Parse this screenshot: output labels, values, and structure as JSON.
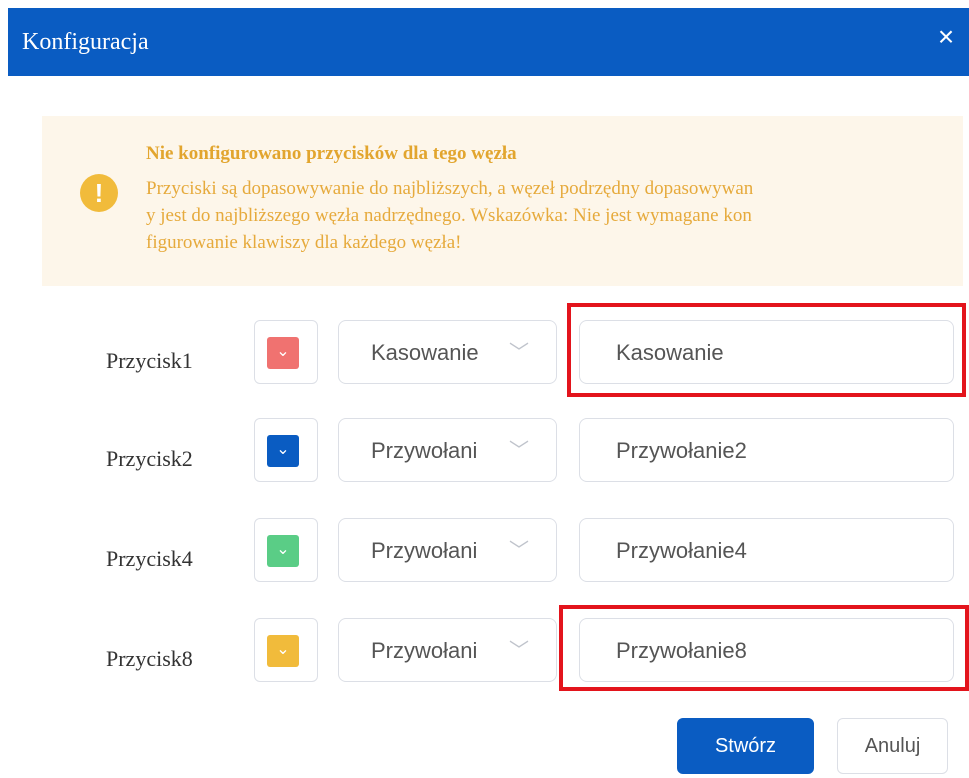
{
  "dialog": {
    "title": "Konfiguracja",
    "close_icon": "×"
  },
  "alert": {
    "icon": "!",
    "heading": "Nie konfigurowano przycisków dla tego węzła",
    "lines": [
      "Przyciski są dopasowywanie do najbliższych, a węzeł podrzędny dopasowywan",
      "y jest do najbliższego węzła nadrzędnego. Wskazówka: Nie jest wymagane kon",
      "figurowanie klawiszy dla każdego węzła!"
    ]
  },
  "rows": [
    {
      "label": "Przycisk1",
      "color": "#f07270",
      "select": "Kasowanie",
      "input": "Kasowanie",
      "highlighted": true
    },
    {
      "label": "Przycisk2",
      "color": "#0a5cc2",
      "select": "Przywołani",
      "input": "Przywołanie2",
      "highlighted": false
    },
    {
      "label": "Przycisk4",
      "color": "#5acd86",
      "select": "Przywołani",
      "input": "Przywołanie4",
      "highlighted": false
    },
    {
      "label": "Przycisk8",
      "color": "#f1bb3b",
      "select": "Przywołani",
      "input": "Przywołanie8",
      "highlighted": true
    }
  ],
  "icons": {
    "swatch_chevron": "⌄",
    "select_chevron": "﹀"
  },
  "buttons": {
    "create": "Stwórz",
    "cancel": "Anuluj"
  },
  "colors": {
    "primary": "#0a5cc2",
    "highlight": "#e3141c",
    "alert_bg": "#fdf6ea",
    "alert_text": "#e6aa3c"
  }
}
